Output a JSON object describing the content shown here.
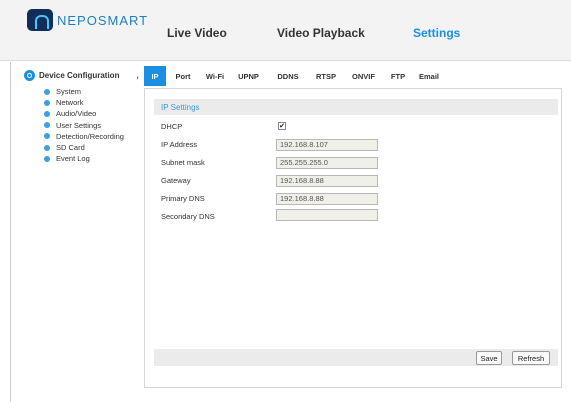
{
  "brand": {
    "name": "NEPOSMART"
  },
  "nav": {
    "live": "Live Video",
    "playback": "Video Playback",
    "settings": "Settings"
  },
  "sidebar": {
    "title": "Device Configuration",
    "arrow": ",",
    "items": [
      {
        "label": "System"
      },
      {
        "label": "Network"
      },
      {
        "label": "Audio/Video"
      },
      {
        "label": "User Settings"
      },
      {
        "label": "Detection/Recording"
      },
      {
        "label": "SD Card"
      },
      {
        "label": "Event Log"
      }
    ]
  },
  "tabs": [
    {
      "label": "IP",
      "active": true
    },
    {
      "label": "Port"
    },
    {
      "label": "Wi-Fi"
    },
    {
      "label": "UPNP"
    },
    {
      "label": "DDNS"
    },
    {
      "label": "RTSP"
    },
    {
      "label": "ONVIF"
    },
    {
      "label": "FTP"
    },
    {
      "label": "Email"
    }
  ],
  "ip_settings": {
    "header": "IP Settings",
    "dhcp": {
      "label": "DHCP",
      "checked": true,
      "mark": "✔"
    },
    "ip_address": {
      "label": "IP Address",
      "value": "192.168.8.107"
    },
    "subnet_mask": {
      "label": "Subnet mask",
      "value": "255.255.255.0"
    },
    "gateway": {
      "label": "Gateway",
      "value": "192.168.8.88"
    },
    "primary_dns": {
      "label": "Primary DNS",
      "value": "192.168.8.88"
    },
    "secondary_dns": {
      "label": "Secondary DNS",
      "value": ""
    }
  },
  "buttons": {
    "save": "Save",
    "refresh": "Refresh"
  },
  "colors": {
    "accent": "#1a8fe3",
    "section_header_text": "#3a9ad9",
    "bullet": "#3aa0e0"
  }
}
